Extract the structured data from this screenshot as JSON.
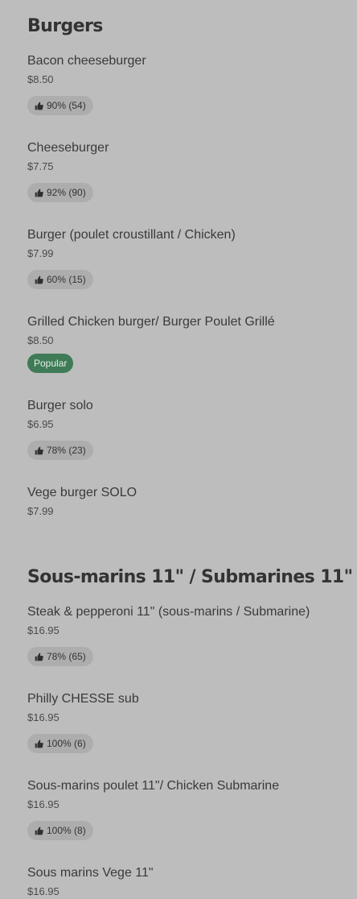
{
  "sections": [
    {
      "title": "Burgers",
      "items": [
        {
          "name": "Bacon cheeseburger",
          "price": "$8.50",
          "rating": "90% (54)"
        },
        {
          "name": "Cheeseburger",
          "price": "$7.75",
          "rating": "92% (90)"
        },
        {
          "name": "Burger (poulet croustillant / Chicken)",
          "price": "$7.99",
          "rating": "60% (15)"
        },
        {
          "name": "Grilled Chicken burger/ Burger Poulet Grillé",
          "price": "$8.50",
          "tag": "Popular"
        },
        {
          "name": "Burger solo",
          "price": "$6.95",
          "rating": "78% (23)"
        },
        {
          "name": "Vege burger SOLO",
          "price": "$7.99"
        }
      ]
    },
    {
      "title": "Sous-marins 11\" / Submarines 11\"",
      "items": [
        {
          "name": "Steak & pepperoni 11\" (sous-marins / Submarine)",
          "price": "$16.95",
          "rating": "78% (65)"
        },
        {
          "name": "Philly CHESSE sub",
          "price": "$16.95",
          "rating": "100% (6)"
        },
        {
          "name": "Sous-marins poulet 11\"/ Chicken Submarine",
          "price": "$16.95",
          "rating": "100% (8)"
        },
        {
          "name": "Sous marins Vege 11\"",
          "price": "$16.95"
        }
      ]
    }
  ],
  "icons": {
    "rating_icon": "thumbs-up-icon"
  },
  "colors": {
    "background": "#bdbdbd",
    "rating_badge": "#adadad",
    "popular_badge": "#3f7b57"
  }
}
